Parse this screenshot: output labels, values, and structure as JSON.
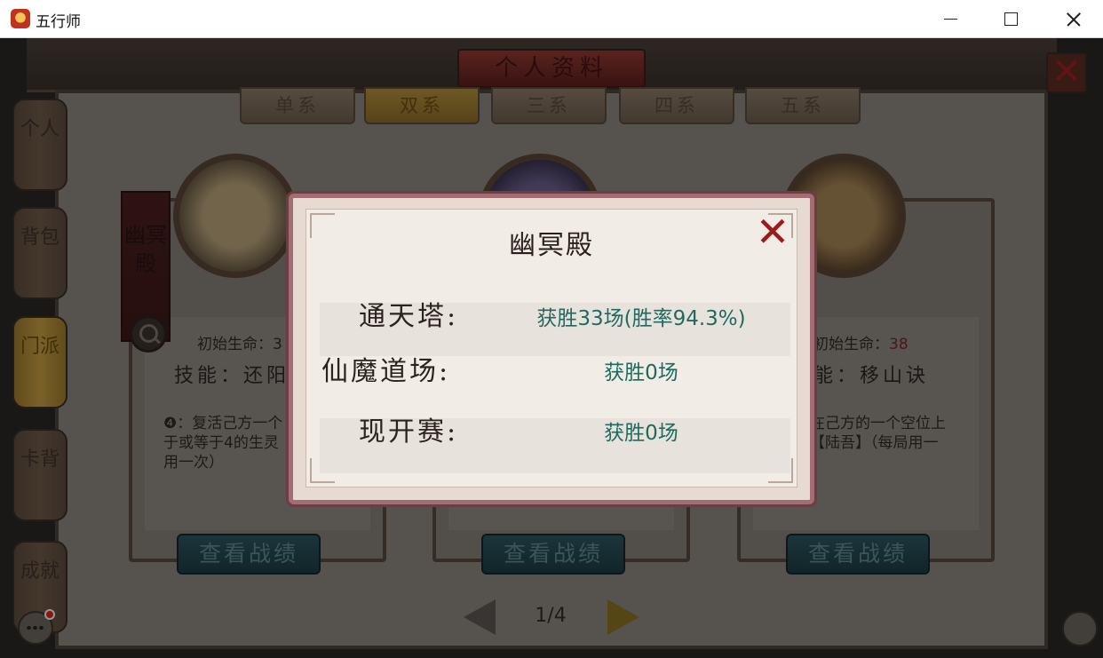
{
  "window": {
    "title": "五行师"
  },
  "header": {
    "title": "个人资料"
  },
  "tabs": [
    {
      "label": "单系",
      "active": false
    },
    {
      "label": "双系",
      "active": true
    },
    {
      "label": "三系",
      "active": false
    },
    {
      "label": "四系",
      "active": false
    },
    {
      "label": "五系",
      "active": false
    }
  ],
  "side_nav": [
    {
      "label": "个人",
      "active": false
    },
    {
      "label": "背包",
      "active": false
    },
    {
      "label": "门派",
      "active": true
    },
    {
      "label": "卡背",
      "active": false
    },
    {
      "label": "成就",
      "active": false
    }
  ],
  "cards": [
    {
      "sect": "幽冥殿",
      "hp_label": "初始生命：3",
      "skill": "技能：还阳",
      "desc_lines": [
        "❹：复活己方一个",
        "于或等于4的生灵",
        "用一次）"
      ],
      "record_button": "查看战绩"
    },
    {
      "record_button": "查看战绩"
    },
    {
      "hp_label": "初始生命：",
      "hp_value": "38",
      "skill": "能：移山诀",
      "desc_lines": [
        "在己方的一个空位上",
        "【陆吾】（每局用一"
      ],
      "record_button": "查看战绩"
    }
  ],
  "pager": {
    "text": "1/4"
  },
  "dialog": {
    "title": "幽冥殿",
    "rows": [
      {
        "label": "通天塔:",
        "value": "获胜33场(胜率94.3%)"
      },
      {
        "label": "仙魔道场:",
        "value": "获胜0场"
      },
      {
        "label": "现开赛:",
        "value": "获胜0场"
      }
    ]
  },
  "colors": {
    "dialog_value": "#1f6b5f",
    "hp_value": "#7a2424",
    "close_x": "#9b1b1b"
  }
}
